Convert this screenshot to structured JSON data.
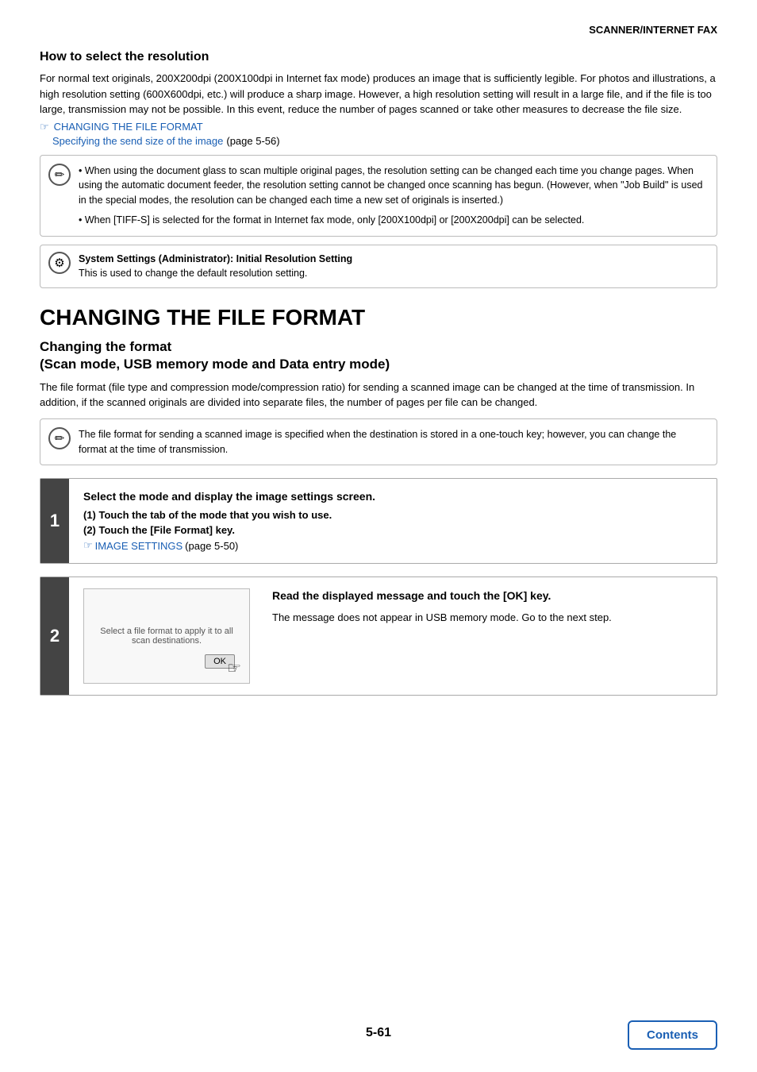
{
  "header": {
    "title": "SCANNER/INTERNET FAX"
  },
  "resolution_section": {
    "heading": "How to select the resolution",
    "body1": "For normal text originals, 200X200dpi (200X100dpi in Internet fax mode) produces an image that is sufficiently legible. For photos and illustrations, a high resolution setting (600X600dpi, etc.) will produce a sharp image. However, a high resolution setting will result in a large file, and if the file is too large, transmission may not be possible. In this event, reduce the number of pages scanned or take other measures to decrease the file size.",
    "link1_icon": "☞",
    "link1_text": "CHANGING THE FILE FORMAT",
    "link2_text": "Specifying the send size of the image",
    "link2_suffix": "(page 5-56)",
    "note1_bullets": [
      "When using the document glass to scan multiple original pages, the resolution setting can be changed each time you change pages. When using the automatic document feeder, the resolution setting cannot be changed once scanning has begun. (However, when \"Job Build\" is used in the special modes, the resolution can be changed each time a new set of originals is inserted.)",
      "When [TIFF-S] is selected for the format in Internet fax mode, only [200X100dpi] or [200X200dpi] can be selected."
    ],
    "settings_bold": "System Settings (Administrator): Initial Resolution Setting",
    "settings_body": "This is used to change the default resolution setting."
  },
  "main_heading": "CHANGING THE FILE FORMAT",
  "changing_format": {
    "heading": "Changing the format",
    "subheading": "(Scan mode, USB memory mode and Data entry mode)",
    "body": "The file format (file type and compression mode/compression ratio) for sending a scanned image can be changed at the time of transmission. In addition, if the scanned originals are divided into separate files, the number of pages per file can be changed.",
    "note_text": "The file format for sending a scanned image is specified when the destination is stored in a one-touch key; however, you can change the format at the time of transmission."
  },
  "step1": {
    "number": "1",
    "heading": "Select the mode and display the image settings screen.",
    "sub1": "(1)  Touch the tab of the mode that you wish to use.",
    "sub2": "(2)  Touch the [File Format] key.",
    "link_icon": "☞",
    "link_text": "IMAGE SETTINGS",
    "link_suffix": "(page 5-50)"
  },
  "step2": {
    "number": "2",
    "image_text": "Select a file format to apply it to\nall scan destinations.",
    "ok_label": "OK",
    "heading": "Read the displayed message and touch the [OK] key.",
    "body": "The message does not appear in USB memory mode. Go to the next step."
  },
  "footer": {
    "page": "5-61",
    "contents_label": "Contents"
  }
}
